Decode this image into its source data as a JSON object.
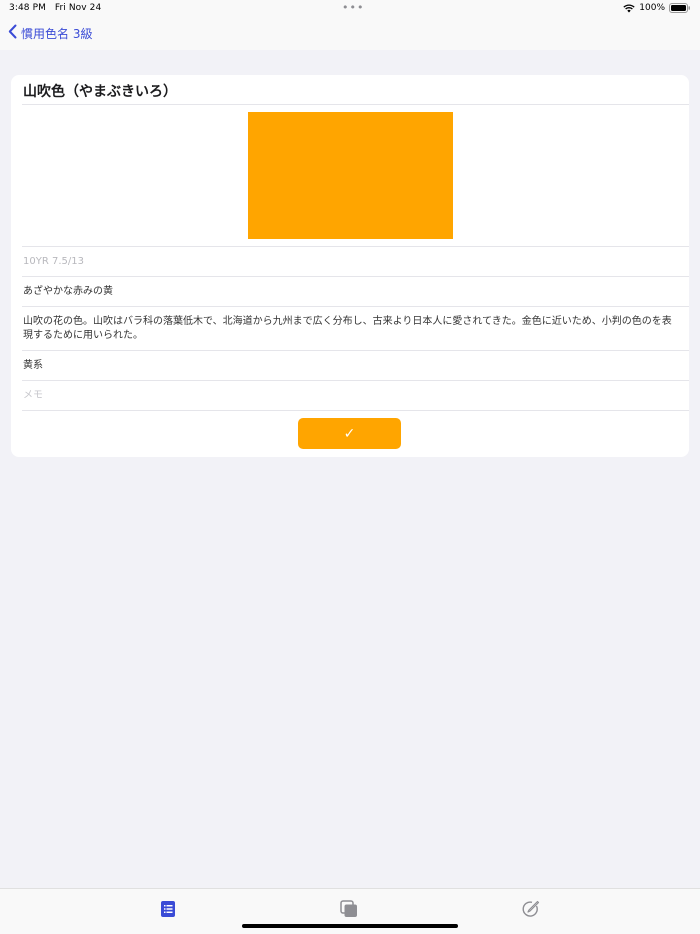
{
  "status_bar": {
    "time": "3:48 PM",
    "date": "Fri Nov 24",
    "battery": "100%",
    "dots": "•••"
  },
  "nav": {
    "back_label": "慣用色名 3級"
  },
  "color_card": {
    "title": "山吹色（やまぶきいろ）",
    "swatch_color": "#ffa500",
    "munsell": "10YR 7.5/13",
    "short_description": "あざやかな赤みの黄",
    "long_description": "山吹の花の色。山吹はバラ科の落葉低木で、北海道から九州まで広く分布し、古来より日本人に愛されてきた。金色に近いため、小判の色のを表現するために用いられた。",
    "category": "黄系",
    "memo_placeholder": "メモ",
    "confirm_icon": "checkmark-icon",
    "confirm_glyph": "✓"
  },
  "tab_bar": {
    "tabs": [
      {
        "icon": "list-icon",
        "active": true
      },
      {
        "icon": "stack-icon",
        "active": false
      },
      {
        "icon": "pencil-circle-icon",
        "active": false
      }
    ],
    "active_color": "#3a4bd6",
    "inactive_color": "#8e8e93"
  },
  "accent_color": "#3a4bd6"
}
